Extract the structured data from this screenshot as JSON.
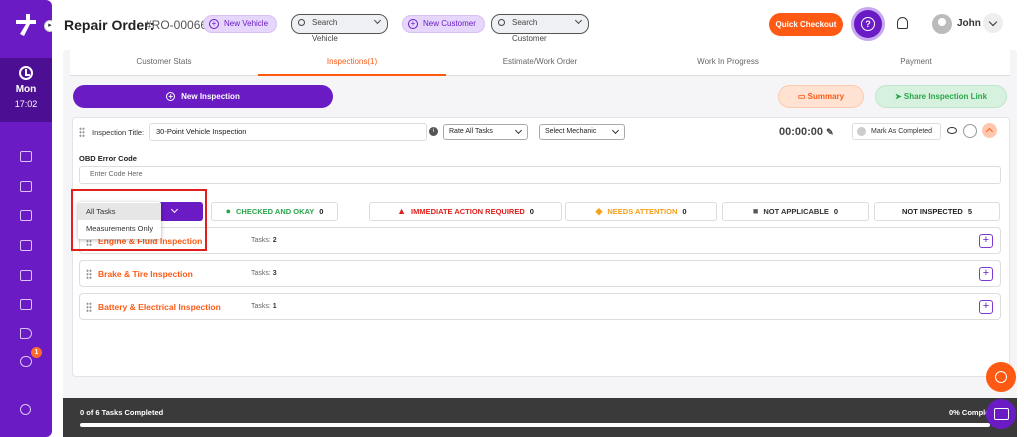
{
  "header": {
    "title": "Repair Order:",
    "ro_number": "#RO-000668",
    "new_vehicle": "New Vehicle",
    "search_vehicle": "Search Vehicle",
    "new_customer": "New Customer",
    "search_customer": "Search Customer",
    "quick_checkout": "Quick Checkout",
    "user_name": "John"
  },
  "sidebar": {
    "day": "Mon",
    "time": "17:02",
    "notification_count": "1"
  },
  "tabs": [
    {
      "label": "Customer Stats"
    },
    {
      "label": "Inspections(1)"
    },
    {
      "label": "Estimate/Work Order"
    },
    {
      "label": "Work In Progress"
    },
    {
      "label": "Payment"
    }
  ],
  "actions": {
    "new_inspection": "New Inspection",
    "summary": "Summary",
    "share_link": "Share Inspection Link"
  },
  "inspection": {
    "title_label": "Inspection Title:",
    "title_value": "30-Point Vehicle Inspection",
    "rate_select": "Rate All Tasks",
    "mechanic_select": "Select Mechanic",
    "timer": "00:00:00",
    "mark_completed": "Mark As Completed",
    "obd_label": "OBD Error Code",
    "obd_placeholder": "Enter Code Here"
  },
  "stats": [
    {
      "label": "CHECKED AND OKAY",
      "count": "0",
      "color": "#2aa54b",
      "icon": "check-circle-icon"
    },
    {
      "label": "IMMEDIATE ACTION REQUIRED",
      "count": "0",
      "color": "#e0201d",
      "icon": "warning-icon"
    },
    {
      "label": "NEEDS ATTENTION",
      "count": "0",
      "color": "#f5a01a",
      "icon": "diamond-alert-icon"
    },
    {
      "label": "NOT APPLICABLE",
      "count": "0",
      "color": "#555555",
      "icon": "x-square-icon"
    },
    {
      "label": "NOT INSPECTED",
      "count": "5",
      "color": "#222222",
      "icon": ""
    }
  ],
  "filter_dropdown": {
    "options": [
      "All Tasks",
      "Measurements Only"
    ],
    "selected": "All Tasks"
  },
  "sections": [
    {
      "name": "Engine & Fluid Inspection",
      "tasks_label": "Tasks:",
      "tasks": "2"
    },
    {
      "name": "Brake & Tire Inspection",
      "tasks_label": "Tasks:",
      "tasks": "3"
    },
    {
      "name": "Battery & Electrical Inspection",
      "tasks_label": "Tasks:",
      "tasks": "1"
    }
  ],
  "footer": {
    "completed": "0 of 6 Tasks Completed",
    "percent": "0% Completed",
    "progress": 0
  },
  "colors": {
    "brand_purple": "#6a1bc4",
    "accent_orange": "#ff5a14"
  }
}
